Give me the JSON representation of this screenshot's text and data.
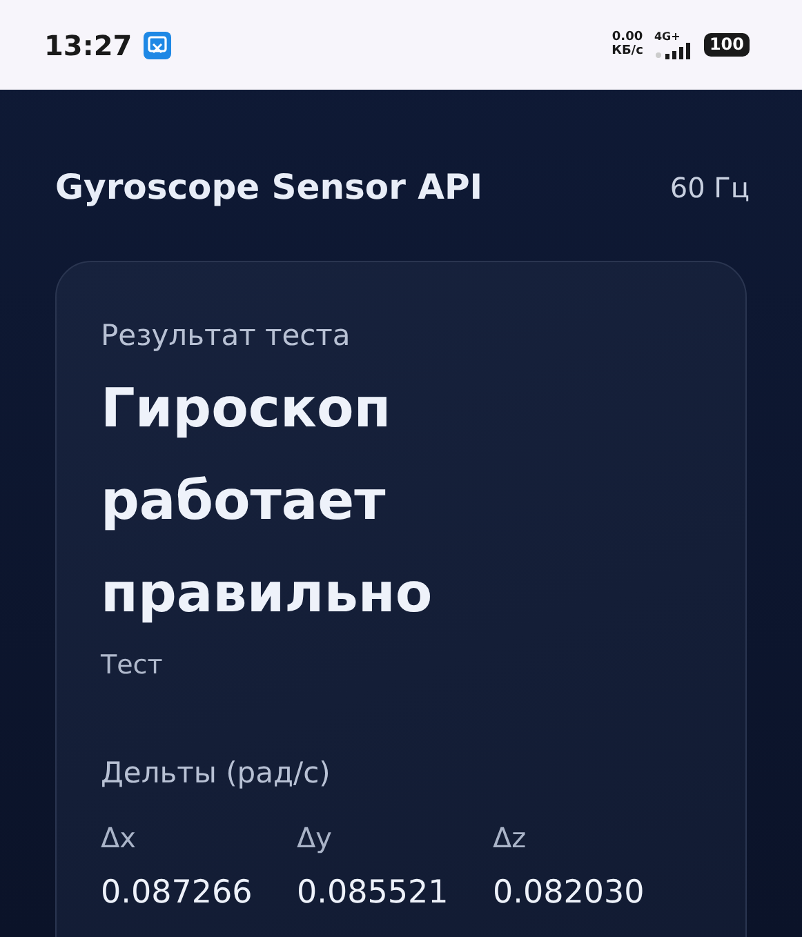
{
  "status_bar": {
    "time": "13:27",
    "net_speed": "0.00",
    "net_unit": "КБ/с",
    "network": "4G+",
    "battery": "100"
  },
  "header": {
    "title": "Gyroscope Sensor API",
    "rate": "60 Гц"
  },
  "result_card": {
    "label": "Результат теста",
    "result": "Гироскоп работает правильно",
    "mode": "Тест",
    "deltas_label": "Дельты (рад/с)",
    "deltas": [
      {
        "axis": "Δx",
        "value": "0.087266"
      },
      {
        "axis": "Δy",
        "value": "0.085521"
      },
      {
        "axis": "Δz",
        "value": "0.082030"
      }
    ]
  }
}
